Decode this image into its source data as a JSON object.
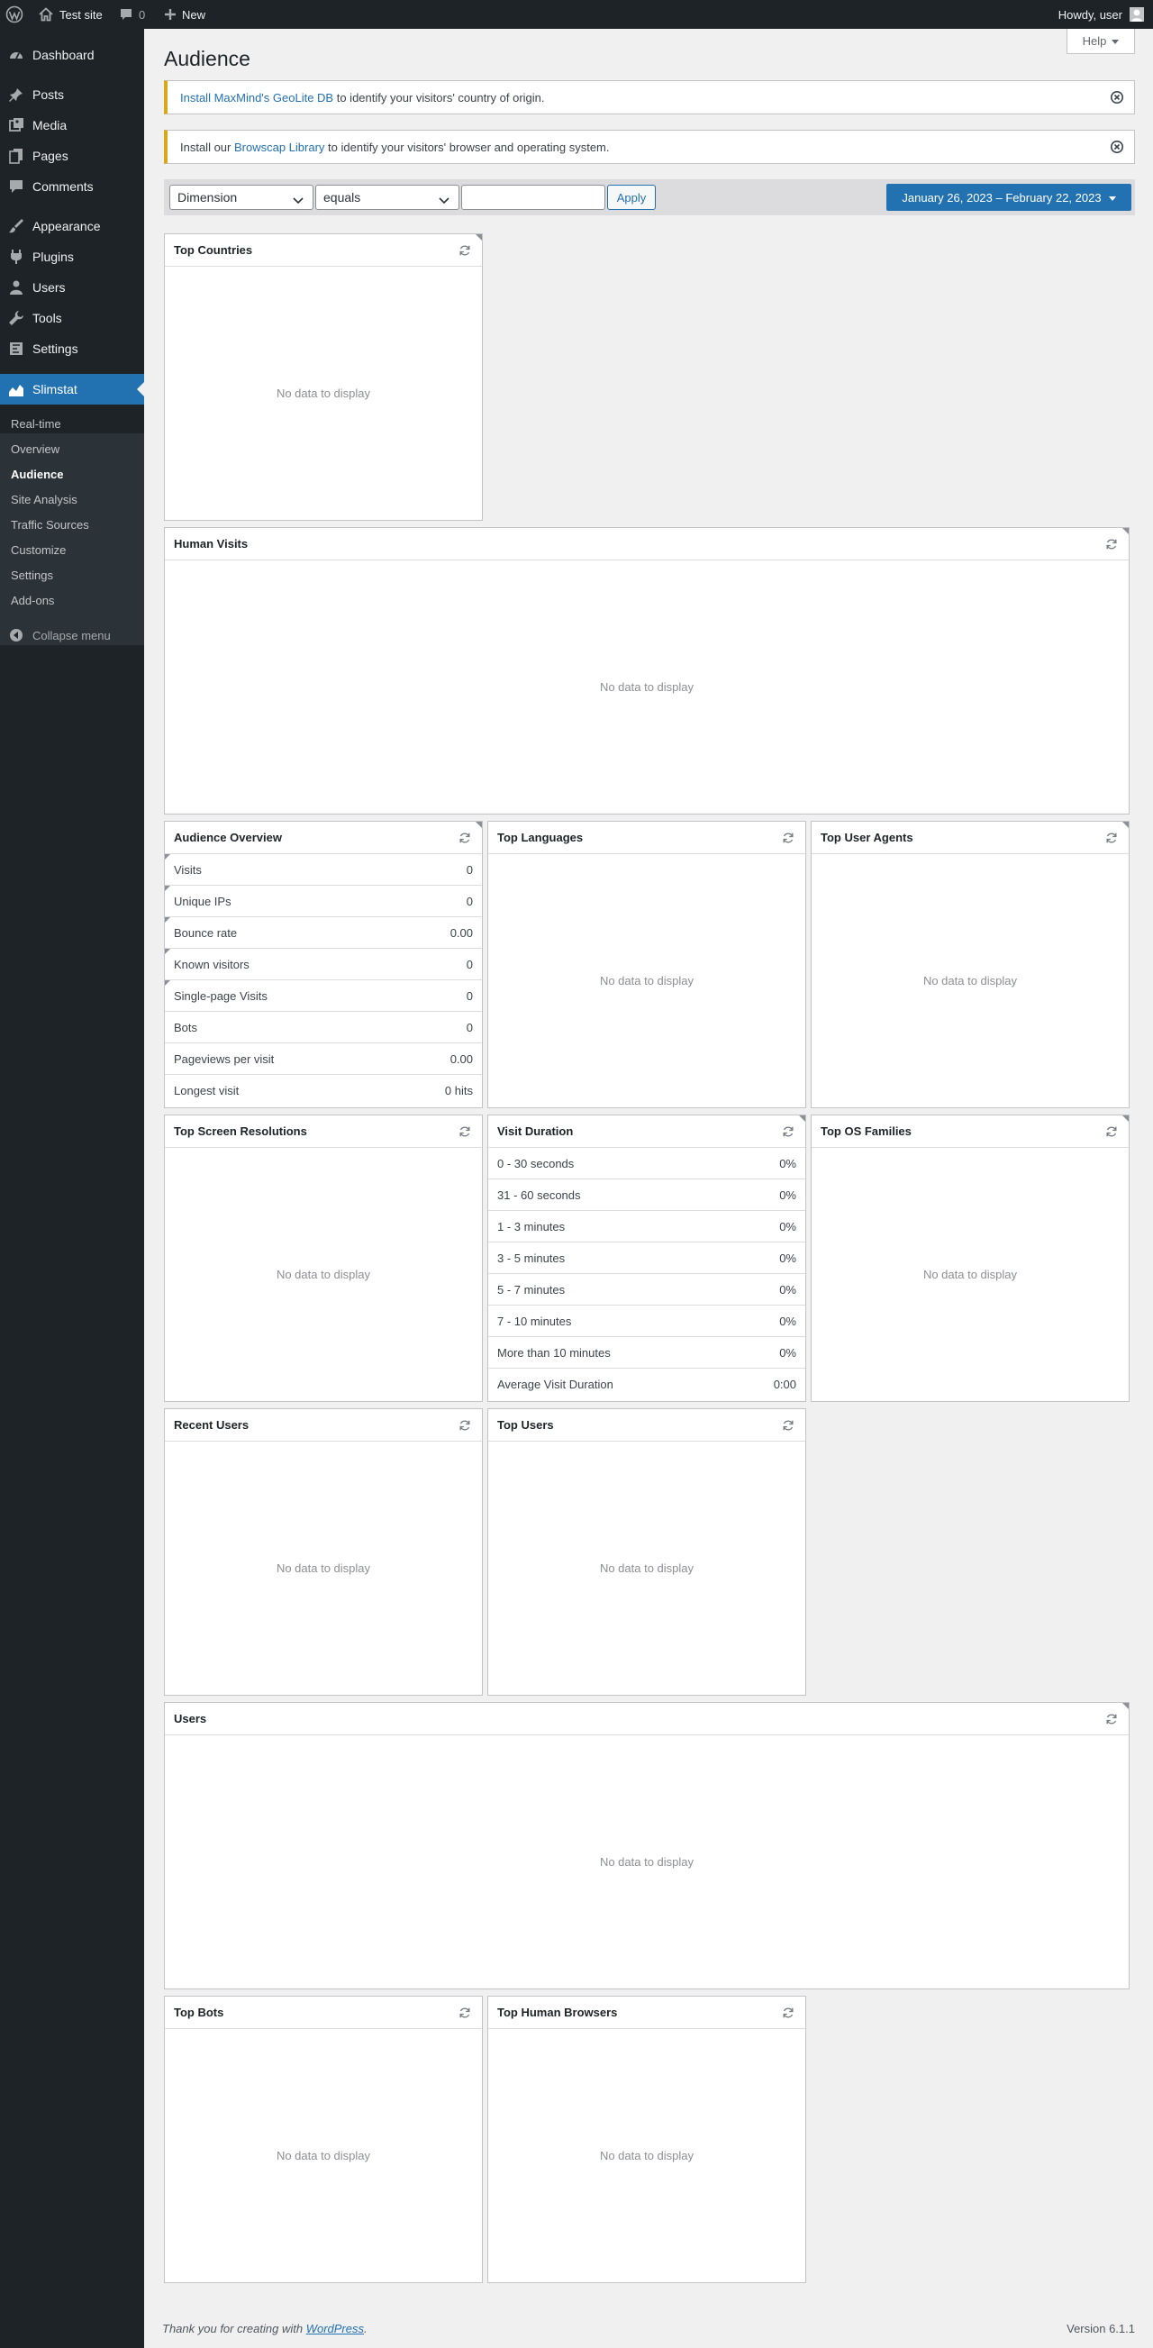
{
  "adminbar": {
    "site_name": "Test site",
    "comments_count": "0",
    "new_label": "New",
    "howdy": "Howdy, user"
  },
  "sidebar": {
    "items": [
      {
        "label": "Dashboard",
        "icon": "dashboard-icon"
      },
      {
        "label": "Posts",
        "icon": "pushpin-icon"
      },
      {
        "label": "Media",
        "icon": "media-icon"
      },
      {
        "label": "Pages",
        "icon": "pages-icon"
      },
      {
        "label": "Comments",
        "icon": "comment-icon"
      },
      {
        "label": "Appearance",
        "icon": "brush-icon"
      },
      {
        "label": "Plugins",
        "icon": "plugin-icon"
      },
      {
        "label": "Users",
        "icon": "user-icon"
      },
      {
        "label": "Tools",
        "icon": "wrench-icon"
      },
      {
        "label": "Settings",
        "icon": "settings-icon"
      },
      {
        "label": "Slimstat",
        "icon": "area-chart-icon"
      }
    ],
    "submenu": [
      "Real-time",
      "Overview",
      "Audience",
      "Site Analysis",
      "Traffic Sources",
      "Customize",
      "Settings",
      "Add-ons"
    ],
    "collapse_label": "Collapse menu"
  },
  "page": {
    "title": "Audience",
    "help_label": "Help"
  },
  "notices": [
    {
      "link": "Install MaxMind's GeoLite DB",
      "before": "",
      "after": " to identify your visitors' country of origin."
    },
    {
      "link": "Browscap Library",
      "before": "Install our ",
      "after": " to identify your visitors' browser and operating system."
    }
  ],
  "filter": {
    "dimension": "Dimension",
    "operator": "equals",
    "value": "",
    "apply_label": "Apply",
    "date_range": "January 26, 2023 – February 22, 2023"
  },
  "no_data": "No data to display",
  "boxes": {
    "top_countries": "Top Countries",
    "human_visits": "Human Visits",
    "audience_overview": {
      "title": "Audience Overview",
      "rows": [
        {
          "label": "Visits",
          "value": "0"
        },
        {
          "label": "Unique IPs",
          "value": "0"
        },
        {
          "label": "Bounce rate",
          "value": "0.00"
        },
        {
          "label": "Known visitors",
          "value": "0"
        },
        {
          "label": "Single-page Visits",
          "value": "0"
        },
        {
          "label": "Bots",
          "value": "0"
        },
        {
          "label": "Pageviews per visit",
          "value": "0.00"
        },
        {
          "label": "Longest visit",
          "value": "0 hits"
        }
      ]
    },
    "top_languages": "Top Languages",
    "top_user_agents": "Top User Agents",
    "top_screen_resolutions": "Top Screen Resolutions",
    "visit_duration": {
      "title": "Visit Duration",
      "rows": [
        {
          "label": "0 - 30 seconds",
          "value": "0%"
        },
        {
          "label": "31 - 60 seconds",
          "value": "0%"
        },
        {
          "label": "1 - 3 minutes",
          "value": "0%"
        },
        {
          "label": "3 - 5 minutes",
          "value": "0%"
        },
        {
          "label": "5 - 7 minutes",
          "value": "0%"
        },
        {
          "label": "7 - 10 minutes",
          "value": "0%"
        },
        {
          "label": "More than 10 minutes",
          "value": "0%"
        },
        {
          "label": "Average Visit Duration",
          "value": "0:00"
        }
      ]
    },
    "top_os_families": "Top OS Families",
    "recent_users": "Recent Users",
    "top_users": "Top Users",
    "users": "Users",
    "top_bots": "Top Bots",
    "top_human_browsers": "Top Human Browsers"
  },
  "footer": {
    "thanks_before": "Thank you for creating with ",
    "thanks_link": "WordPress",
    "thanks_after": ".",
    "version": "Version 6.1.1"
  }
}
